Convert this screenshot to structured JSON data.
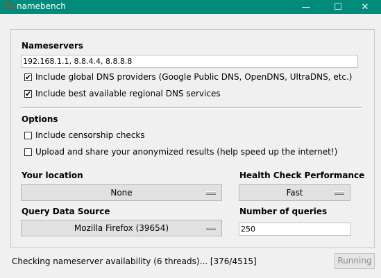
{
  "window": {
    "title": "namebench",
    "icon_glyph": "7ь",
    "minimize_glyph": "—",
    "maximize_glyph": "☐",
    "close_glyph": "✕"
  },
  "nameservers": {
    "heading": "Nameservers",
    "value": "192.168.1.1, 8.8.4.4, 8.8.8.8",
    "include_global_label": "Include global DNS providers (Google Public DNS, OpenDNS, UltraDNS, etc.)",
    "include_global_checked": true,
    "include_regional_label": "Include best available regional DNS services",
    "include_regional_checked": true
  },
  "options": {
    "heading": "Options",
    "censorship_label": "Include censorship checks",
    "censorship_checked": false,
    "upload_label": "Upload and share your anonymized results (help speed up the internet!)",
    "upload_checked": false
  },
  "location": {
    "heading": "Your location",
    "value": "None"
  },
  "health": {
    "heading": "Health Check Performance",
    "value": "Fast"
  },
  "query_source": {
    "heading": "Query Data Source",
    "value": "Mozilla Firefox (39654)"
  },
  "queries": {
    "heading": "Number of queries",
    "value": "250"
  },
  "status": {
    "text": "Checking nameserver availability (6 threads)... [376/4515]",
    "button_label": "Running"
  },
  "check_glyph": "✔"
}
